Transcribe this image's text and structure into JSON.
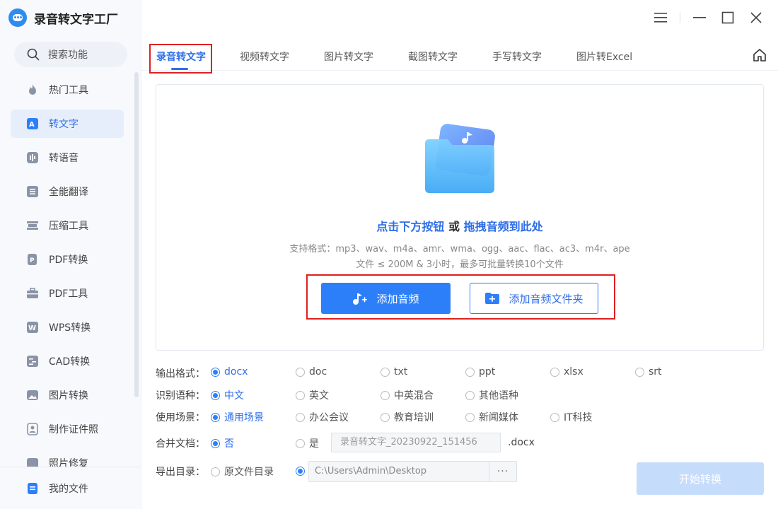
{
  "app": {
    "name": "录音转文字工厂"
  },
  "sidebar": {
    "search_label": "搜索功能",
    "items": [
      {
        "label": "热门工具",
        "icon": "flame-icon"
      },
      {
        "label": "转文字",
        "icon": "text-convert-icon",
        "active": true
      },
      {
        "label": "转语音",
        "icon": "voice-icon"
      },
      {
        "label": "全能翻译",
        "icon": "translate-icon"
      },
      {
        "label": "压缩工具",
        "icon": "compress-icon"
      },
      {
        "label": "PDF转换",
        "icon": "pdf-convert-icon"
      },
      {
        "label": "PDF工具",
        "icon": "toolbox-icon"
      },
      {
        "label": "WPS转换",
        "icon": "wps-icon"
      },
      {
        "label": "CAD转换",
        "icon": "cad-icon"
      },
      {
        "label": "图片转换",
        "icon": "image-convert-icon"
      },
      {
        "label": "制作证件照",
        "icon": "id-photo-icon"
      },
      {
        "label": "照片修复",
        "icon": "photo-repair-icon"
      }
    ],
    "my_files_label": "我的文件"
  },
  "tabs": [
    {
      "label": "录音转文字",
      "active": true
    },
    {
      "label": "视频转文字"
    },
    {
      "label": "图片转文字"
    },
    {
      "label": "截图转文字"
    },
    {
      "label": "手写转文字"
    },
    {
      "label": "图片转Excel"
    }
  ],
  "dropzone": {
    "headline_click": "点击下方按钮",
    "headline_or": " 或 ",
    "headline_drag": "拖拽音频到此处",
    "formats": "支持格式：mp3、wav、m4a、amr、wma、ogg、aac、flac、ac3、m4r、ape",
    "limits": "文件 ≤ 200M & 3小时，最多可批量转换10个文件",
    "add_audio_label": "添加音频",
    "add_folder_label": "添加音频文件夹"
  },
  "options": {
    "output_format": {
      "label": "输出格式：",
      "choices": [
        "docx",
        "doc",
        "txt",
        "ppt",
        "xlsx",
        "srt"
      ],
      "selected": "docx"
    },
    "language": {
      "label": "识别语种：",
      "choices": [
        "中文",
        "英文",
        "中英混合",
        "其他语种"
      ],
      "selected": "中文"
    },
    "scenario": {
      "label": "使用场景：",
      "choices": [
        "通用场景",
        "办公会议",
        "教育培训",
        "新闻媒体",
        "IT科技"
      ],
      "selected": "通用场景"
    },
    "merge": {
      "label": "合并文档：",
      "no_label": "否",
      "yes_label": "是",
      "selected": "否",
      "filename": "录音转文字_20230922_151456",
      "ext": ".docx"
    },
    "export_dir": {
      "label": "导出目录：",
      "source_label": "原文件目录",
      "path": "C:\\Users\\Admin\\Desktop",
      "browse_label": "···"
    }
  },
  "start_label": "开始转换",
  "colors": {
    "accent": "#2d7ff9",
    "highlight_box": "#e02020",
    "start_disabled": "#c6dcfb"
  }
}
